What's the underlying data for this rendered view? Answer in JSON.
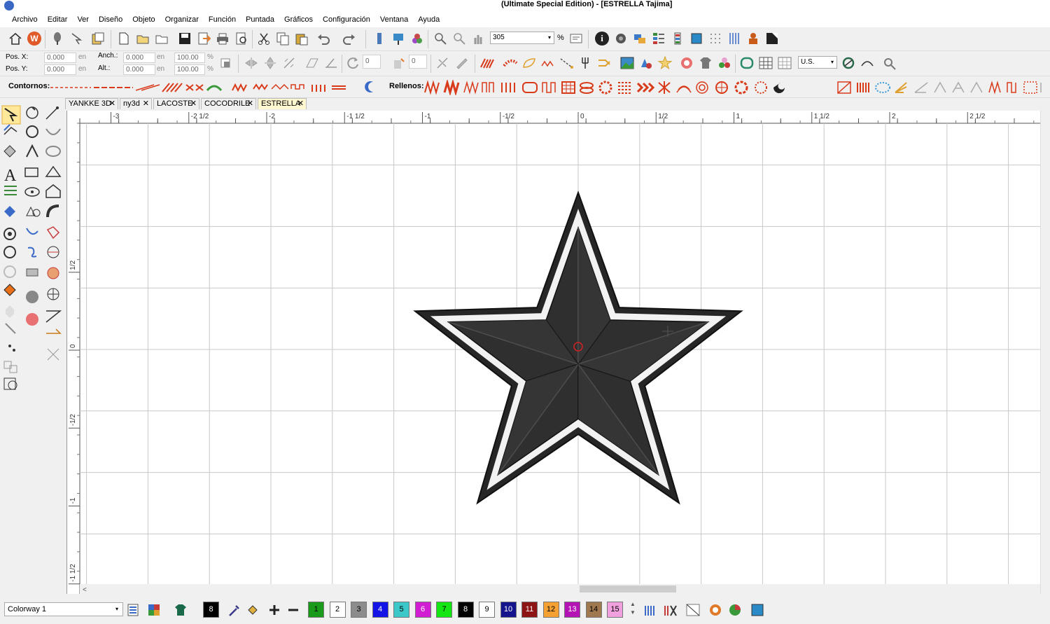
{
  "window": {
    "title": "(Ultimate Special Edition) - [ESTRELLA        Tajima]"
  },
  "menu": [
    "Archivo",
    "Editar",
    "Ver",
    "Diseño",
    "Objeto",
    "Organizar",
    "Función",
    "Puntada",
    "Gráficos",
    "Configuración",
    "Ventana",
    "Ayuda"
  ],
  "toolbar": {
    "zoom_value": "305",
    "zoom_unit": "%"
  },
  "position": {
    "pos_x_label": "Pos. X:",
    "pos_x": "0.000",
    "pos_x_unit": "en",
    "pos_y_label": "Pos. Y:",
    "pos_y": "0.000",
    "pos_y_unit": "en",
    "width_label": "Anch.:",
    "width": "0.000",
    "width_unit": "en",
    "height_label": "Alt.:",
    "height": "0.000",
    "height_unit": "en",
    "scale_x": "100.00",
    "scale_y": "100.00",
    "pct": "%",
    "rotate_value": "0",
    "slant_value": "0",
    "units_select": "U.S."
  },
  "stitchbar": {
    "contornos_label": "Contornos:",
    "rellenos_label": "Rellenos:"
  },
  "tabs": [
    {
      "label": "YANKKE 3D",
      "active": false
    },
    {
      "label": "ny3d",
      "active": false
    },
    {
      "label": "LACOSTE",
      "active": false
    },
    {
      "label": "COCODRILE",
      "active": false
    },
    {
      "label": "ESTRELLA",
      "active": true
    }
  ],
  "ruler_h": [
    "-3",
    "-2 1/2",
    "-2",
    "-1 1/2",
    "-1",
    "-1/2",
    "0",
    "1/2",
    "1",
    "1 1/2",
    "2",
    "2 1/2"
  ],
  "ruler_v": [
    "1/2",
    "0",
    "-1/2",
    "-1",
    "-1 1/2"
  ],
  "colorway": {
    "label": "Colorway 1"
  },
  "colors": {
    "star_dark": "#2b2b2b",
    "star_white": "#f2f2f2",
    "accent_red": "#d22222"
  },
  "swatch_current": "8",
  "swatches": [
    {
      "num": "1",
      "color": "#1a9a1a",
      "text": "#000"
    },
    {
      "num": "2",
      "color": "#ffffff",
      "text": "#000"
    },
    {
      "num": "3",
      "color": "#8c8c8c",
      "text": "#000"
    },
    {
      "num": "4",
      "color": "#1414e6",
      "text": "#fff"
    },
    {
      "num": "5",
      "color": "#3cc8c8",
      "text": "#000"
    },
    {
      "num": "6",
      "color": "#d21ed2",
      "text": "#fff"
    },
    {
      "num": "7",
      "color": "#14e614",
      "text": "#000"
    },
    {
      "num": "8",
      "color": "#000000",
      "text": "#fff"
    },
    {
      "num": "9",
      "color": "#ffffff",
      "text": "#000"
    },
    {
      "num": "10",
      "color": "#14148c",
      "text": "#fff"
    },
    {
      "num": "11",
      "color": "#8c1414",
      "text": "#fff"
    },
    {
      "num": "12",
      "color": "#f5a033",
      "text": "#000"
    },
    {
      "num": "13",
      "color": "#b414b4",
      "text": "#fff"
    },
    {
      "num": "14",
      "color": "#a07850",
      "text": "#000"
    },
    {
      "num": "15",
      "color": "#f0a0dc",
      "text": "#000"
    }
  ]
}
